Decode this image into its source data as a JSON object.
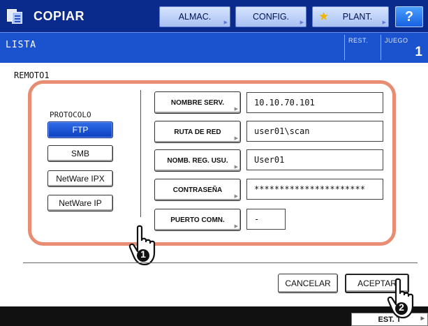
{
  "header": {
    "app_title": "COPIAR",
    "buttons": {
      "almac": "ALMAC.",
      "config": "CONFIG.",
      "plant": "PLANT.",
      "help": "?"
    }
  },
  "subheader": {
    "title": "LISTA",
    "rest_label": "REST.",
    "juego_label": "JUEGO",
    "juego_value": "1"
  },
  "form": {
    "entry_name": "REMOTO1",
    "protocol": {
      "label": "PROTOCOLO",
      "options": [
        "FTP",
        "SMB",
        "NetWare IPX",
        "NetWare IP"
      ],
      "selected": "FTP"
    },
    "fields": [
      {
        "button": "NOMBRE SERV.",
        "value": "10.10.70.101"
      },
      {
        "button": "RUTA DE RED",
        "value": "user01\\scan"
      },
      {
        "button": "NOMB. REG. USU.",
        "value": "User01"
      },
      {
        "button": "CONTRASEÑA",
        "value": "**********************"
      },
      {
        "button": "PUERTO COMN.",
        "value": "-"
      }
    ]
  },
  "actions": {
    "cancel": "CANCELAR",
    "accept": "ACEPTAR"
  },
  "footer": {
    "status_button": "EST. T"
  },
  "callouts": {
    "step1": "1",
    "step2": "2"
  },
  "colors": {
    "topbar": "#0a2a8c",
    "subbar": "#1b53cf",
    "panel_border": "#e88c74",
    "selected": "#1b53cf"
  }
}
